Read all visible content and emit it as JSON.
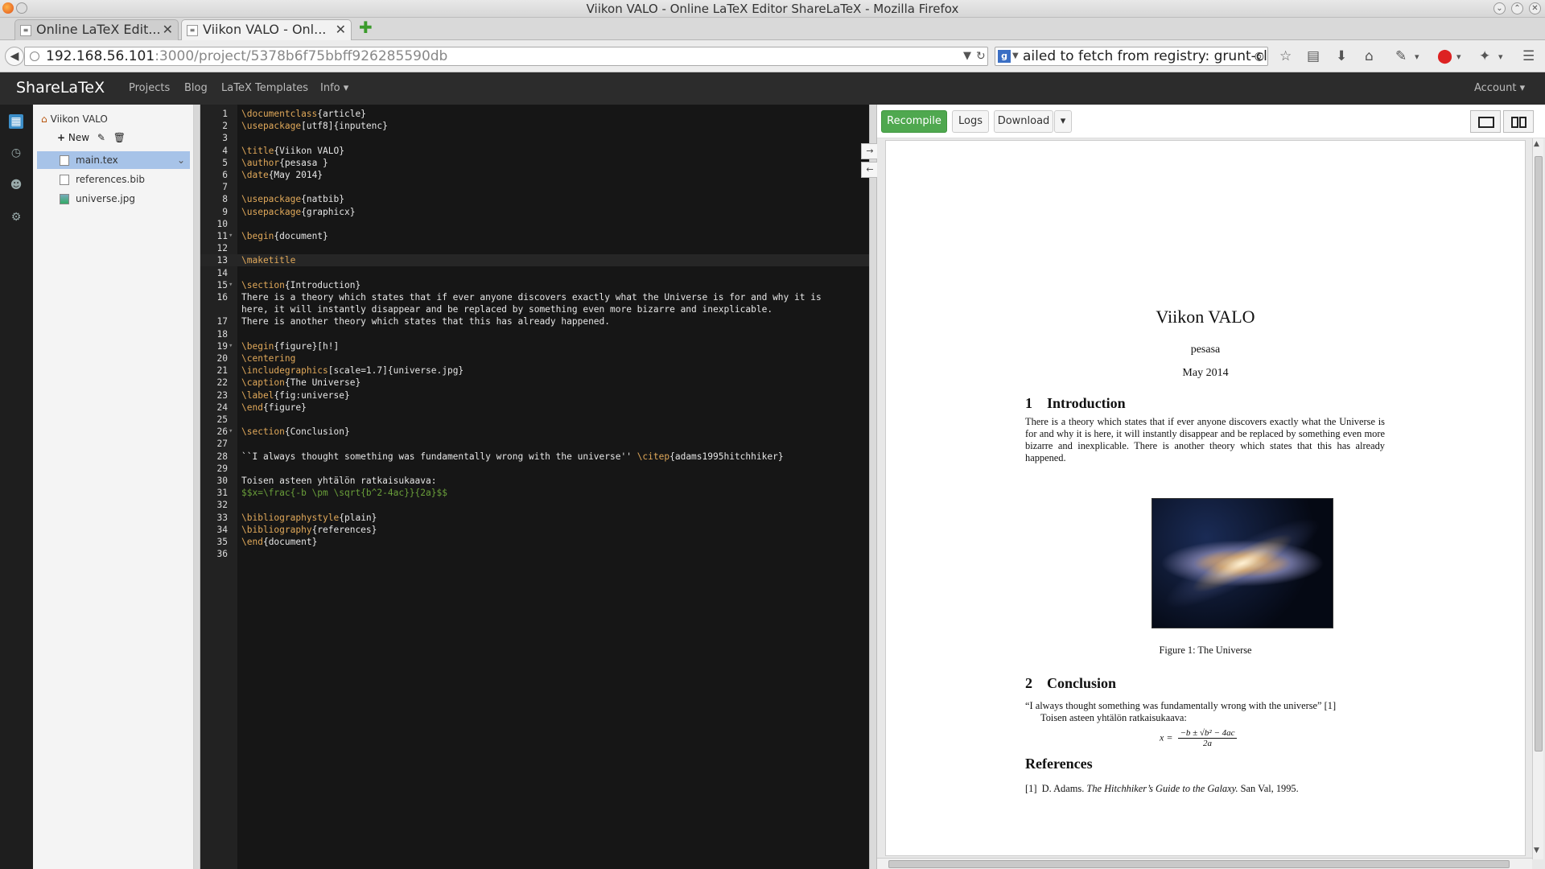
{
  "window": {
    "title": "Viikon VALO - Online LaTeX Editor ShareLaTeX - Mozilla Firefox"
  },
  "tabs": [
    {
      "label": "Online LaTeX Edit...",
      "close": "✕"
    },
    {
      "label": "Viikon VALO - Onl...",
      "close": "✕"
    }
  ],
  "newtab": "✚",
  "address": {
    "host": "192.168.56.101",
    "rest": ":3000/project/5378b6f75bbff926285590db"
  },
  "search": {
    "value": "ailed to fetch from registry: grunt-cli"
  },
  "app": {
    "brand": "ShareLaTeX",
    "menu": [
      "Projects",
      "Blog",
      "LaTeX Templates",
      "Info ▾"
    ],
    "account": "Account ▾"
  },
  "filetree": {
    "project": "Viikon VALO",
    "new_label": "New",
    "files": [
      "main.tex",
      "references.bib",
      "universe.jpg"
    ]
  },
  "editor": {
    "lines": [
      "<span class=\"cmd\">\\documentclass</span>{article}",
      "<span class=\"cmd\">\\usepackage</span>[utf8]{inputenc}",
      "",
      "<span class=\"cmd\">\\title</span>{Viikon VALO}",
      "<span class=\"cmd\">\\author</span>{pesasa }",
      "<span class=\"cmd\">\\date</span>{May 2014}",
      "",
      "<span class=\"cmd\">\\usepackage</span>{natbib}",
      "<span class=\"cmd\">\\usepackage</span>{graphicx}",
      "",
      "<span class=\"cmd\">\\begin</span>{document}",
      "",
      "<span class=\"cmd\">\\maketitle</span>",
      "",
      "<span class=\"cmd\">\\section</span>{Introduction}",
      "There is a theory which states that if ever anyone discovers exactly what the Universe is for and why it is",
      "here, it will instantly disappear and be replaced by something even more bizarre and inexplicable.",
      "There is another theory which states that this has already happened.",
      "",
      "<span class=\"cmd\">\\begin</span>{figure}[h!]",
      "<span class=\"cmd\">\\centering</span>",
      "<span class=\"cmd\">\\includegraphics</span>[scale=1.7]{universe.jpg}",
      "<span class=\"cmd\">\\caption</span>{The Universe}",
      "<span class=\"cmd\">\\label</span>{fig:universe}",
      "<span class=\"cmd\">\\end</span>{figure}",
      "",
      "<span class=\"cmd\">\\section</span>{Conclusion}",
      "",
      "``I always thought something was fundamentally wrong with the universe'' <span class=\"cmd\">\\citep</span>{adams1995hitchhiker}",
      "",
      "Toisen asteen yhtälön ratkaisukaava:",
      "<span class=\"math\">$$x=\\frac{-b \\pm \\sqrt{b^2-4ac}}{2a}$$</span>",
      "",
      "<span class=\"cmd\">\\bibliographystyle</span>{plain}",
      "<span class=\"cmd\">\\bibliography</span>{references}",
      "<span class=\"cmd\">\\end</span>{document}",
      ""
    ],
    "line_numbers": [
      "1",
      "2",
      "3",
      "4",
      "5",
      "6",
      "7",
      "8",
      "9",
      "10",
      "11",
      "12",
      "13",
      "14",
      "15",
      "16",
      "",
      "17",
      "18",
      "19",
      "20",
      "21",
      "22",
      "23",
      "24",
      "25",
      "26",
      "27",
      "28",
      "29",
      "30",
      "31",
      "32",
      "33",
      "34",
      "35",
      "36"
    ],
    "fold_lines": [
      "11",
      "15",
      "19",
      "26"
    ],
    "highlighted_line": "13"
  },
  "pdf_toolbar": {
    "recompile": "Recompile",
    "logs": "Logs",
    "download": "Download",
    "caret": "▾"
  },
  "pdf": {
    "title": "Viikon VALO",
    "author": "pesasa",
    "date": "May 2014",
    "sec1": "1    Introduction",
    "intro": "There is a theory which states that if ever anyone discovers exactly what the Universe is for and why it is here, it will instantly disappear and be replaced by something even more bizarre and inexplicable. There is another theory which states that this has already happened.",
    "caption": "Figure 1: The Universe",
    "sec2": "2    Conclusion",
    "quote": "“I always thought something was fundamentally wrong with the universe” [1]",
    "text2": "Toisen asteen yhtälön ratkaisukaava:",
    "eq_lhs": "x =",
    "eq_num": "−b ± √b² − 4ac",
    "eq_den": "2a",
    "refs_heading": "References",
    "ref1_a": "[1]  D. Adams.",
    "ref1_title": "The Hitchhiker’s Guide to the Galaxy.",
    "ref1_b": "San Val, 1995."
  }
}
